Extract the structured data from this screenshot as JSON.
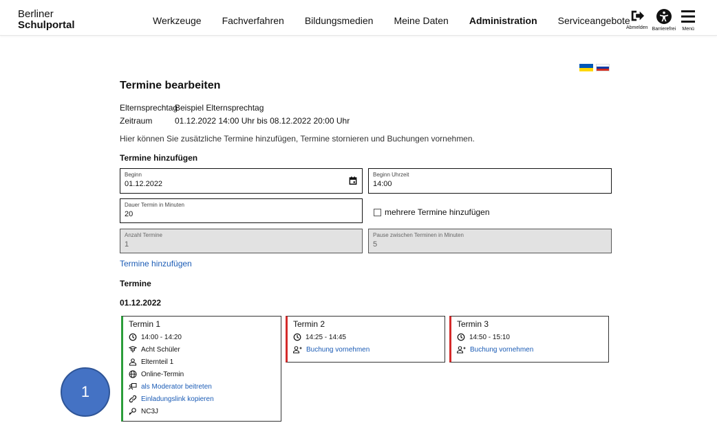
{
  "header": {
    "brand_line1": "Berliner",
    "brand_line2": "Schulportal",
    "nav": [
      {
        "label": "Werkzeuge"
      },
      {
        "label": "Fachverfahren"
      },
      {
        "label": "Bildungsmedien"
      },
      {
        "label": "Meine Daten"
      },
      {
        "label": "Administration"
      },
      {
        "label": "Serviceangebote"
      }
    ],
    "actions": {
      "logout_label": "Abmelden",
      "accessibility_label": "Barrierefrei",
      "menu_label": "Menü"
    }
  },
  "flags": [
    {
      "name": "ukrainian-flag-icon",
      "colors": [
        "#0057b7",
        "#ffd700"
      ]
    },
    {
      "name": "russian-flag-icon",
      "colors": [
        "#ffffff",
        "#0039a6",
        "#d52b1e"
      ]
    }
  ],
  "page": {
    "title": "Termine bearbeiten",
    "info": [
      {
        "key": "Elternsprechtag",
        "value": "Beispiel Elternsprechtag"
      },
      {
        "key": "Zeitraum",
        "value": "01.12.2022 14:00 Uhr bis 08.12.2022 20:00 Uhr"
      }
    ],
    "description": "Hier können Sie zusätzliche Termine hinzufügen, Termine stornieren und Buchungen vornehmen."
  },
  "add_section": {
    "title": "Termine hinzufügen",
    "fields": {
      "beginn": {
        "label": "Beginn",
        "value": "01.12.2022"
      },
      "beginn_uhrzeit": {
        "label": "Beginn Uhrzeit",
        "value": "14:00"
      },
      "dauer": {
        "label": "Dauer Termin in Minuten",
        "value": "20"
      },
      "anzahl": {
        "label": "Anzahl Termine",
        "value": "1"
      },
      "pause": {
        "label": "Pause zwischen Terminen in Minuten",
        "value": "5"
      }
    },
    "multi_checkbox_label": "mehrere Termine hinzufügen",
    "add_link": "Termine hinzufügen"
  },
  "termine": {
    "title": "Termine",
    "date": "01.12.2022",
    "cards": [
      {
        "title": "Termin 1",
        "status_color": "#2a9d3a",
        "time": "14:00 - 14:20",
        "student": "Acht Schüler",
        "parent": "Elternteil 1",
        "type": "Online-Termin",
        "moderator_link": "als Moderator beitreten",
        "invite_link": "Einladungslink kopieren",
        "code": "NC3J"
      },
      {
        "title": "Termin 2",
        "status_color": "#d42a2a",
        "time": "14:25 - 14:45",
        "booking_link": "Buchung vornehmen"
      },
      {
        "title": "Termin 3",
        "status_color": "#d42a2a",
        "time": "14:50 - 15:10",
        "booking_link": "Buchung vornehmen"
      }
    ]
  },
  "badge": {
    "number": "1",
    "color": "#4472c4"
  }
}
